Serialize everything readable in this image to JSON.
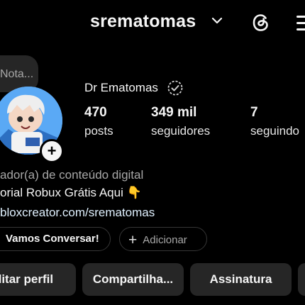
{
  "header": {
    "username": "srematomas",
    "chevron_icon": "chevron-down-icon",
    "threads_icon": "threads-icon",
    "menu_icon": "menu-icon"
  },
  "note": {
    "text": "Nota..."
  },
  "profile": {
    "full_name": "Dr Ematomas",
    "verified_icon": "verified-badge-icon",
    "add_story_icon": "plus-icon",
    "stats": [
      {
        "value": "470",
        "label": "posts"
      },
      {
        "value": "349 mil",
        "label": "seguidores"
      },
      {
        "value": "7",
        "label": "seguindo"
      }
    ],
    "category": "ador(a) de conteúdo digital",
    "bio": "orial Robux Grátis Aqui 👇",
    "link": "bloxcreator.com/srematomas"
  },
  "chips": {
    "conversation": "Vamos Conversar!",
    "add_label": "Adicionar"
  },
  "actions": {
    "edit": "ditar perfil",
    "share": "Compartilha...",
    "subscribe": "Assinatura"
  },
  "colors": {
    "background": "#000000",
    "button": "#262626",
    "link": "#e0f1ff"
  }
}
